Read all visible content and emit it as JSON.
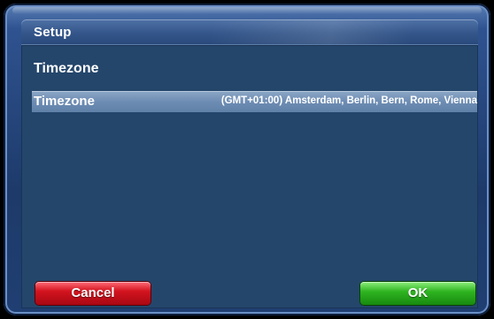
{
  "window": {
    "title": "Setup"
  },
  "section": {
    "heading": "Timezone"
  },
  "settings": [
    {
      "label": "Timezone",
      "value": "(GMT+01:00) Amsterdam, Berlin, Bern, Rome, Vienna",
      "selected": true
    }
  ],
  "buttons": {
    "cancel_label": "Cancel",
    "ok_label": "OK"
  },
  "colors": {
    "cancel": "#d3141f",
    "ok": "#2fb421",
    "panel": "#24466b",
    "selected_row": "#6e8db3"
  }
}
